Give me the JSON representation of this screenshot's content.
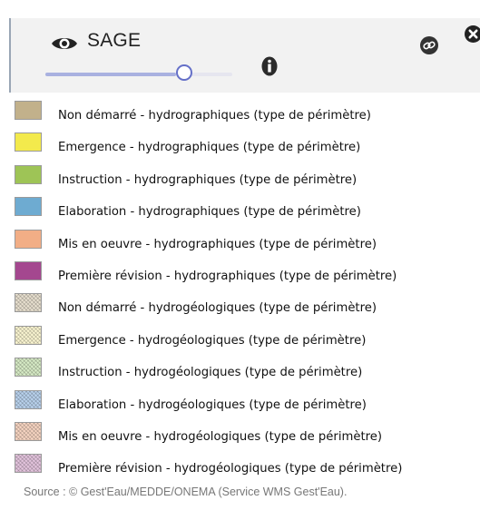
{
  "layer": {
    "title": "SAGE",
    "opacity_percent": 70
  },
  "legend": [
    {
      "label": "Non démarré - hydrographiques (type de périmètre)",
      "color": "#c2b18b",
      "hatched": false
    },
    {
      "label": "Emergence - hydrographiques (type de périmètre)",
      "color": "#f3ea4c",
      "hatched": false
    },
    {
      "label": "Instruction - hydrographiques (type de périmètre)",
      "color": "#9ec456",
      "hatched": false
    },
    {
      "label": "Elaboration - hydrographiques (type de périmètre)",
      "color": "#6eabd1",
      "hatched": false
    },
    {
      "label": "Mis en oeuvre - hydrographiques (type de périmètre)",
      "color": "#f2ae86",
      "hatched": false
    },
    {
      "label": "Première révision - hydrographiques (type de périmètre)",
      "color": "#a4478f",
      "hatched": false
    },
    {
      "label": "Non démarré - hydrogéologiques (type de périmètre)",
      "color": "#e9e1d0",
      "hatched": true
    },
    {
      "label": "Emergence - hydrogéologiques (type de périmètre)",
      "color": "#fbf6d2",
      "hatched": true
    },
    {
      "label": "Instruction - hydrogéologiques (type de périmètre)",
      "color": "#d8ecc7",
      "hatched": true
    },
    {
      "label": "Elaboration - hydrogéologiques (type de périmètre)",
      "color": "#bad3ee",
      "hatched": true
    },
    {
      "label": "Mis en oeuvre - hydrogéologiques (type de périmètre)",
      "color": "#f8d6c3",
      "hatched": true
    },
    {
      "label": "Première révision - hydrogéologiques (type de périmètre)",
      "color": "#e4c5de",
      "hatched": true
    }
  ],
  "source": "Source : © Gest'Eau/MEDDE/ONEMA (Service WMS Gest'Eau)."
}
